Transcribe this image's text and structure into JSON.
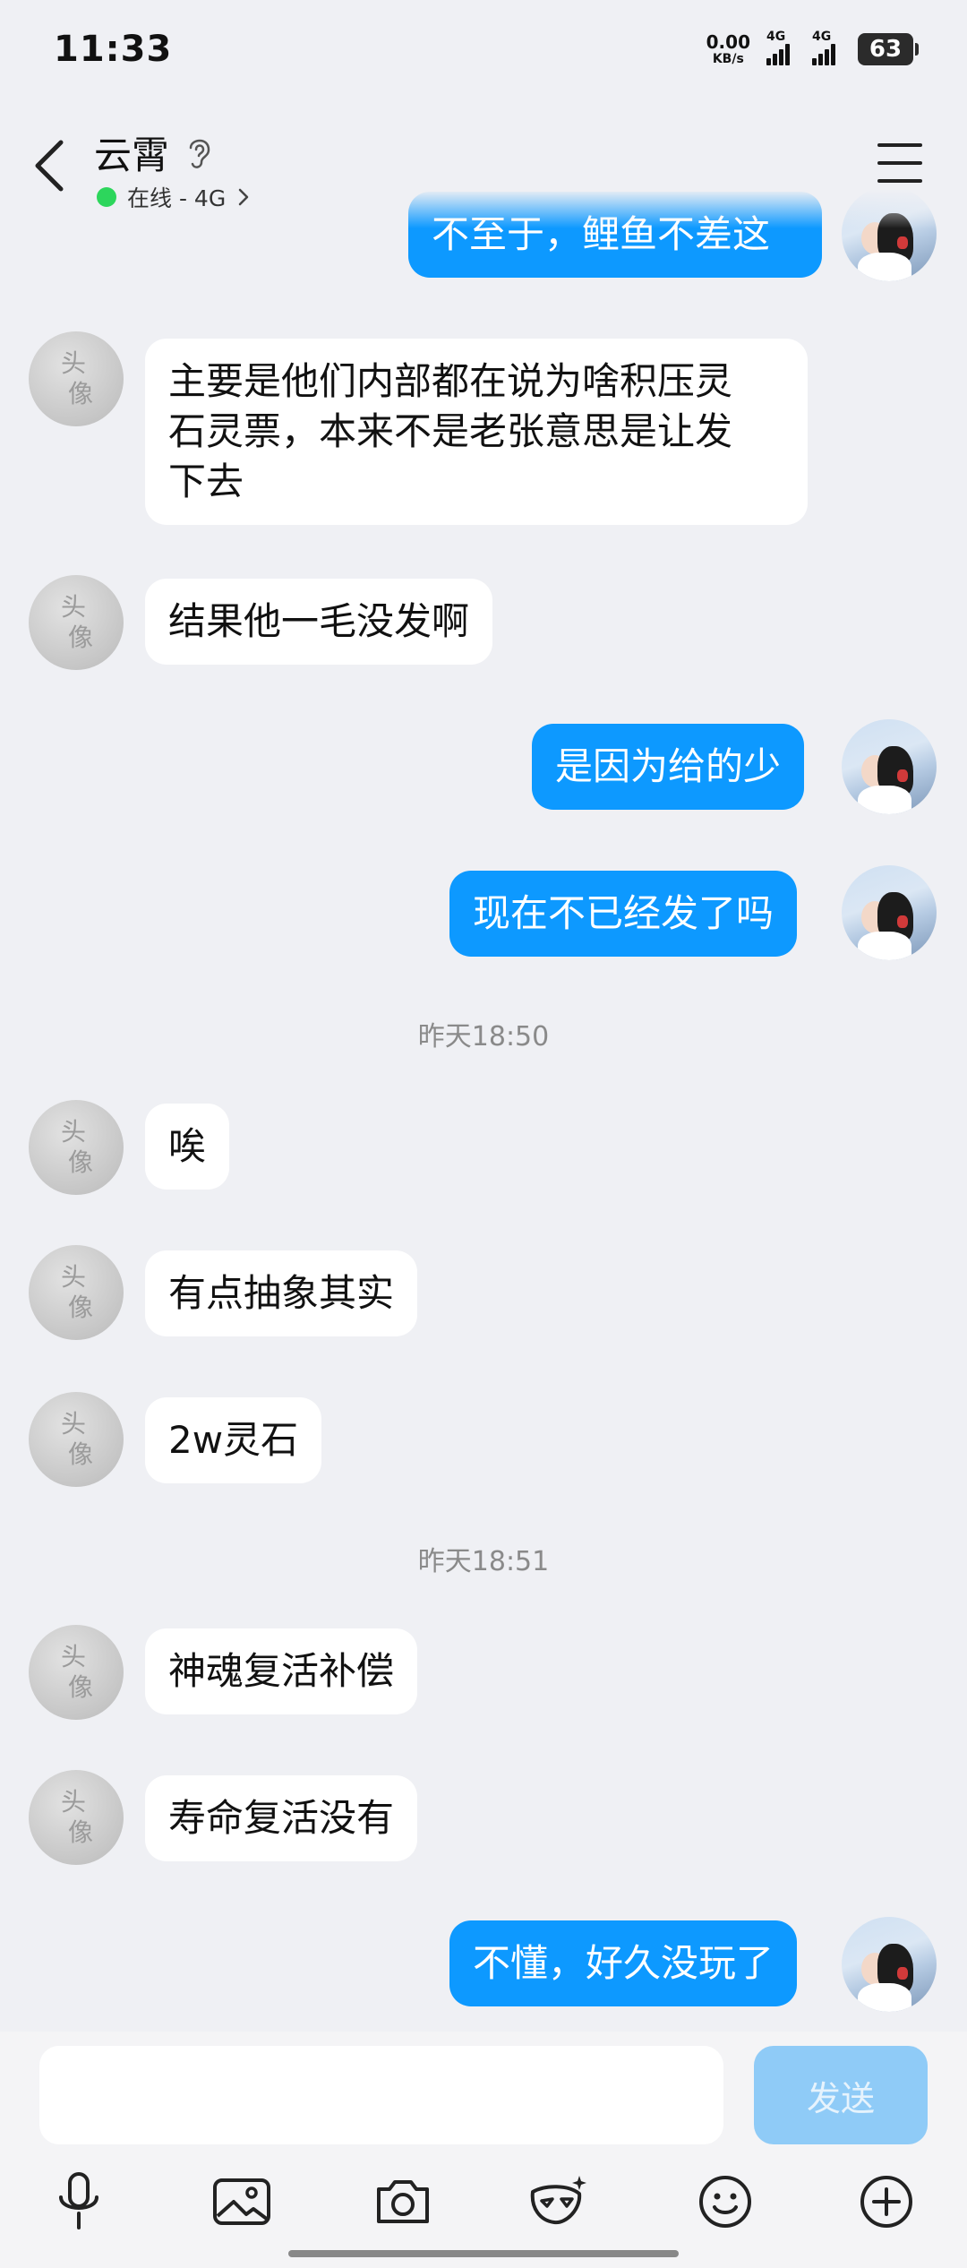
{
  "status_bar": {
    "time": "11:33",
    "net_speed_value": "0.00",
    "net_speed_unit": "KB/s",
    "signal1_label": "4G",
    "signal2_label": "4G",
    "battery": "63"
  },
  "header": {
    "contact_name": "云霄",
    "presence": "在线 - 4G",
    "presence_color": "#2dd65c"
  },
  "messages": [
    {
      "side": "out",
      "text": "不至于，鲤鱼不差这"
    },
    {
      "side": "in",
      "text": "主要是他们内部都在说为啥积压灵\n石灵票，本来不是老张意思是让发\n下去"
    },
    {
      "side": "in",
      "text": "结果他一毛没发啊"
    },
    {
      "side": "out",
      "text": "是因为给的少"
    },
    {
      "side": "out",
      "text": "现在不已经发了吗"
    },
    {
      "side": "in",
      "text": "唉"
    },
    {
      "side": "in",
      "text": "有点抽象其实"
    },
    {
      "side": "in",
      "text": "2w灵石"
    },
    {
      "side": "in",
      "text": "神魂复活补偿"
    },
    {
      "side": "in",
      "text": "寿命复活没有"
    },
    {
      "side": "out",
      "text": "不懂，好久没玩了"
    }
  ],
  "timestamps": [
    "昨天18:50",
    "昨天18:51"
  ],
  "other_avatar": {
    "line1": "头",
    "line2": "像"
  },
  "input": {
    "value": "",
    "placeholder": ""
  },
  "send_label": "发送",
  "colors": {
    "outgoing_bubble": "#0d99ff",
    "incoming_bubble": "#ffffff",
    "background": "#eff0f4",
    "send_disabled": "#8fcbf7"
  },
  "toolbar_icons": [
    "microphone-icon",
    "image-icon",
    "camera-icon",
    "face-mask-icon",
    "emoji-icon",
    "plus-icon"
  ]
}
